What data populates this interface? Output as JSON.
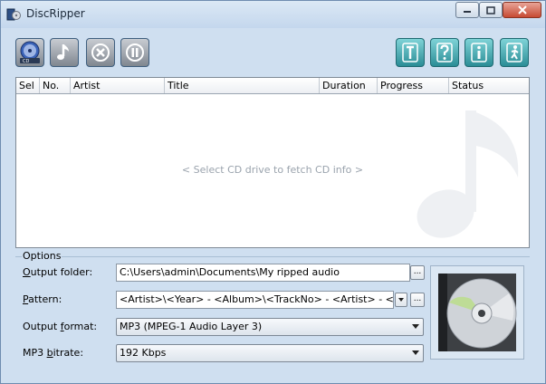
{
  "window": {
    "title": "DiscRipper"
  },
  "toolbar": {
    "left_buttons": [
      {
        "icon": "cd-drive-icon"
      },
      {
        "icon": "music-note-icon"
      },
      {
        "icon": "stop-icon"
      },
      {
        "icon": "pause-icon"
      }
    ],
    "right_buttons": [
      {
        "icon": "tag-icon"
      },
      {
        "icon": "help-icon"
      },
      {
        "icon": "info-icon"
      },
      {
        "icon": "exit-icon"
      }
    ]
  },
  "tracklist": {
    "columns": [
      "Sel",
      "No.",
      "Artist",
      "Title",
      "Duration",
      "Progress",
      "Status"
    ],
    "empty_text": "< Select CD drive to fetch CD info >"
  },
  "options": {
    "group_label": "Options",
    "output_folder": {
      "label_prefix": "",
      "label_key": "O",
      "label_rest": "utput folder:",
      "value": "C:\\Users\\admin\\Documents\\My ripped audio"
    },
    "pattern": {
      "label_key": "P",
      "label_rest": "attern:",
      "value": "<Artist>\\<Year> - <Album>\\<TrackNo> - <Artist> - <Track>"
    },
    "output_format": {
      "label_prefix": "Output ",
      "label_key": "f",
      "label_rest": "ormat:",
      "value": "MP3 (MPEG-1 Audio Layer 3)"
    },
    "mp3_bitrate": {
      "label_prefix": "MP3 ",
      "label_key": "b",
      "label_rest": "itrate:",
      "value": "192 Kbps"
    },
    "browse_label": "..."
  }
}
